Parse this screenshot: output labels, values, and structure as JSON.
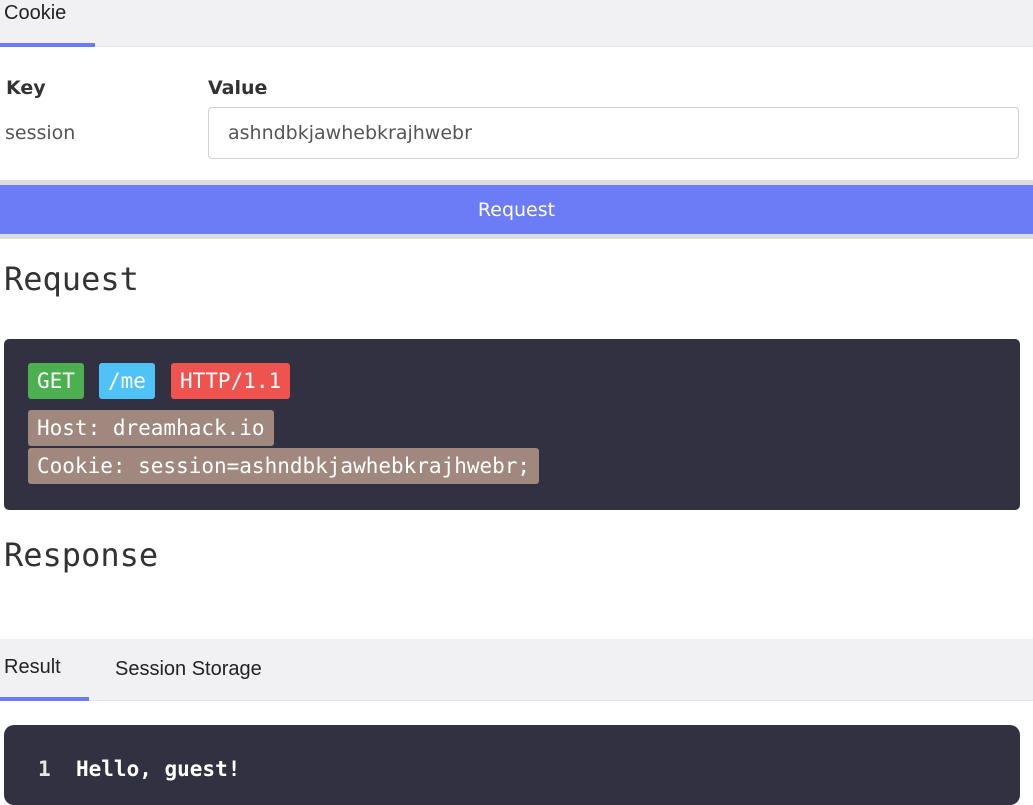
{
  "cookie_tabs": {
    "active_label": "Cookie"
  },
  "cookie_table": {
    "key_header": "Key",
    "value_header": "Value",
    "row": {
      "key": "session",
      "value": "ashndbkjawhebkrajhwebr"
    }
  },
  "request_button": {
    "label": "Request"
  },
  "request_section": {
    "title": "Request",
    "method": "GET",
    "path": "/me",
    "version": "HTTP/1.1",
    "host_header": "Host: dreamhack.io",
    "cookie_header": "Cookie: session=ashndbkjawhebkrajhwebr;"
  },
  "response_section": {
    "title": "Response"
  },
  "result_tabs": {
    "result_label": "Result",
    "session_storage_label": "Session Storage"
  },
  "result_output": {
    "lines": [
      {
        "number": "1",
        "text": "Hello, guest!"
      }
    ]
  },
  "colors": {
    "accent": "#6b7cf6",
    "method_chip": "#4caf50",
    "path_chip": "#4fc3f7",
    "version_chip": "#ef5350",
    "header_chip": "#a1887f",
    "code_background": "#323142"
  }
}
